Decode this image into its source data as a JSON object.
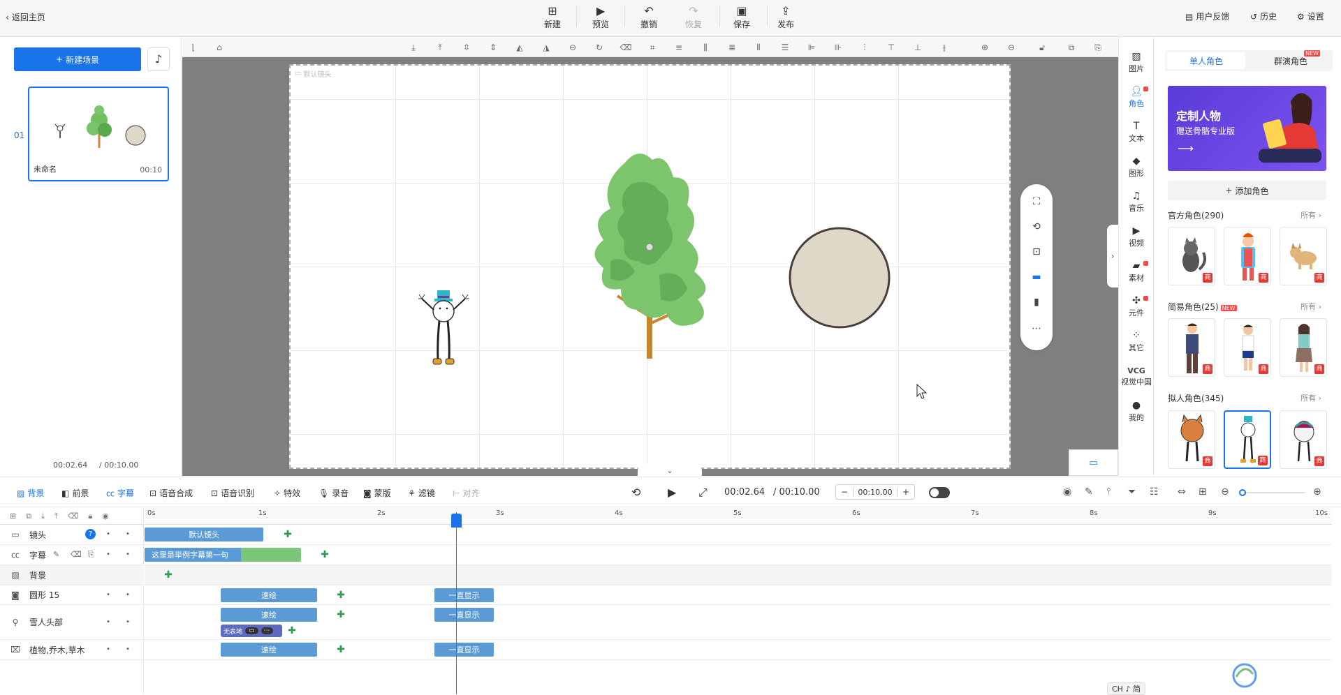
{
  "topbar": {
    "back_label": "返回主页",
    "actions": [
      {
        "label": "新建",
        "icon": "plus-square-icon"
      },
      {
        "label": "预览",
        "icon": "play-icon"
      },
      {
        "label": "撤销",
        "icon": "undo-icon"
      },
      {
        "label": "恢复",
        "icon": "redo-icon"
      },
      {
        "label": "保存",
        "icon": "save-icon"
      },
      {
        "label": "发布",
        "icon": "publish-icon"
      }
    ],
    "right": [
      {
        "label": "用户反馈",
        "icon": "feedback-icon"
      },
      {
        "label": "历史",
        "icon": "history-icon"
      },
      {
        "label": "设置",
        "icon": "gear-icon"
      }
    ]
  },
  "left": {
    "new_scene_label": "新建场景",
    "scene_index": "01",
    "scene_name": "未命名",
    "scene_duration": "00:10",
    "current_time": "00:02.64",
    "total_time": "/ 00:10.00"
  },
  "stage": {
    "camera_label": "默认镜头"
  },
  "right_icons": [
    {
      "label": "图片",
      "icon": "image-icon",
      "dot": false
    },
    {
      "label": "角色",
      "icon": "character-icon",
      "dot": true,
      "active": true
    },
    {
      "label": "文本",
      "icon": "text-icon",
      "dot": false
    },
    {
      "label": "图形",
      "icon": "shape-icon",
      "dot": false
    },
    {
      "label": "音乐",
      "icon": "music-icon",
      "dot": false
    },
    {
      "label": "视频",
      "icon": "video-icon",
      "dot": false
    },
    {
      "label": "素材",
      "icon": "folder-icon",
      "dot": true
    },
    {
      "label": "元件",
      "icon": "pinwheel-icon",
      "dot": true
    },
    {
      "label": "其它",
      "icon": "grid-icon",
      "dot": false
    },
    {
      "label": "视觉中国",
      "icon": "vcg-icon",
      "dot": false,
      "brand": "VCG"
    },
    {
      "label": "我的",
      "icon": "user-icon",
      "dot": false
    }
  ],
  "right_panel": {
    "tab_single": "单人角色",
    "tab_group": "群演角色",
    "new_badge": "NEW",
    "banner_title": "定制人物",
    "banner_sub": "赠送骨骼专业版",
    "add_role_label": "添加角色",
    "sections": [
      {
        "title": "官方角色(290)",
        "all": "所有 ›",
        "new": false
      },
      {
        "title": "简易角色(25)",
        "all": "所有 ›",
        "new": true
      },
      {
        "title": "拟人角色(345)",
        "all": "所有 ›",
        "new": false
      }
    ],
    "shang": "商"
  },
  "timeline_toolbar": {
    "tools": [
      {
        "label": "背景",
        "icon": "background-icon",
        "active": true
      },
      {
        "label": "前景",
        "icon": "foreground-icon",
        "active": false
      },
      {
        "label": "字幕",
        "icon": "subtitle-icon",
        "active": true
      },
      {
        "label": "语音合成",
        "icon": "tts-icon",
        "active": false
      },
      {
        "label": "语音识别",
        "icon": "asr-icon",
        "active": false
      },
      {
        "label": "特效",
        "icon": "effect-icon",
        "active": false
      },
      {
        "label": "录音",
        "icon": "mic-icon",
        "active": false
      },
      {
        "label": "蒙版",
        "icon": "mask-icon",
        "active": false
      },
      {
        "label": "滤镜",
        "icon": "filter-icon",
        "active": false
      },
      {
        "label": "对齐",
        "icon": "align-icon",
        "active": false,
        "disabled": true
      }
    ],
    "current_time": "00:02.64",
    "total_time": "/ 00:10.00",
    "duration_value": "00:10.00",
    "minus": "−",
    "plus": "+"
  },
  "timeline": {
    "ruler": [
      "0s",
      "1s",
      "2s",
      "3s",
      "4s",
      "5s",
      "6s",
      "7s",
      "8s",
      "9s",
      "10s"
    ],
    "rows": [
      {
        "label": "镜头",
        "icon": "camera-icon"
      },
      {
        "label": "字幕",
        "icon": "subtitle-icon"
      },
      {
        "label": "背景",
        "icon": "background-icon"
      },
      {
        "label": "圆形 15",
        "icon": "circle-icon"
      },
      {
        "label": "雪人头部",
        "icon": "figure-icon"
      },
      {
        "label": "植物,乔木,草木",
        "icon": "plant-icon"
      }
    ],
    "camera_clip": "默认镜头",
    "subtitle_clip": "这里是举例字幕第一句",
    "speed_clip": "速绘",
    "always_clip": "一直显示",
    "action_clip": "无表地"
  },
  "ime": "CH ♪ 简"
}
